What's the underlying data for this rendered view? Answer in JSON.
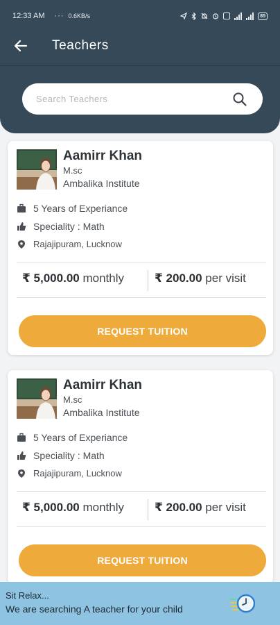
{
  "status_bar": {
    "time": "12:33 AM",
    "dots": "···",
    "net_rate": "0.6KB/s",
    "battery": "85"
  },
  "header": {
    "title": "Teachers"
  },
  "search": {
    "placeholder": "Search Teachers",
    "value": ""
  },
  "teachers": [
    {
      "name": "Aamirr Khan",
      "degree": "M.sc",
      "institute": "Ambalika Institute",
      "experience": "5 Years of Experiance",
      "speciality": "Speciality : Math",
      "location": "Rajajipuram, Lucknow",
      "monthly_amount": "₹ 5,000.00",
      "monthly_label": "monthly",
      "visit_amount": "₹ 200.00",
      "visit_label": "per visit",
      "button": "REQUEST TUITION"
    },
    {
      "name": "Aamirr Khan",
      "degree": "M.sc",
      "institute": "Ambalika Institute",
      "experience": "5 Years of Experiance",
      "speciality": "Speciality : Math",
      "location": "Rajajipuram, Lucknow",
      "monthly_amount": "₹ 5,000.00",
      "monthly_label": "monthly",
      "visit_amount": "₹ 200.00",
      "visit_label": "per visit",
      "button": "REQUEST TUITION"
    }
  ],
  "banner": {
    "line1": "Sit Relax...",
    "line2": "We are searching A teacher for your child"
  },
  "colors": {
    "header_bg": "#364958",
    "accent_button": "#eeaa3a",
    "banner_bg": "#8ec3e2",
    "card_bg": "#ffffff"
  },
  "icons": {
    "back": "arrow-left-icon",
    "search": "search-icon",
    "experience": "briefcase-icon",
    "speciality": "thumbs-up-icon",
    "location": "location-pin-icon"
  }
}
